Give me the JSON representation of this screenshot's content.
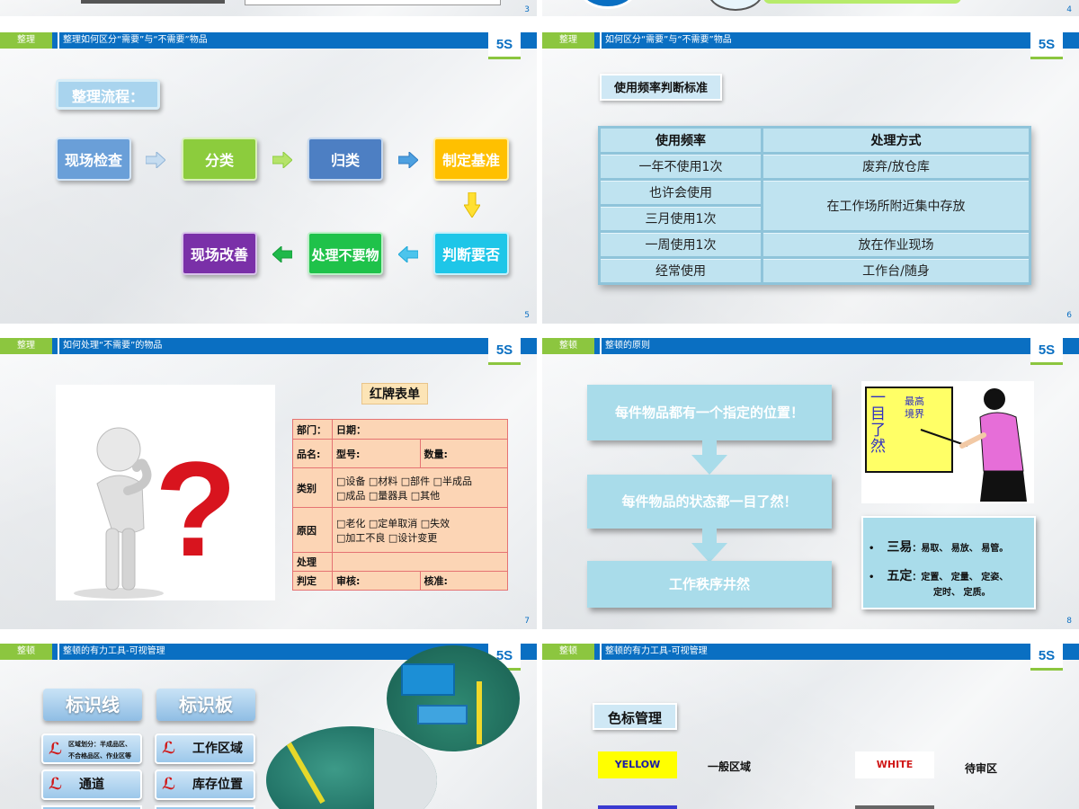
{
  "top": {
    "page3": "3",
    "page4": "4"
  },
  "s5": {
    "tag": "整理",
    "title": "整理如何区分“需要”与“不需要”物品",
    "logo": "5S",
    "page": "5",
    "heading": "整理流程：",
    "steps": [
      "现场检查",
      "分类",
      "归类",
      "制定基准",
      "判断要否",
      "处理不要物",
      "现场改善"
    ]
  },
  "s6": {
    "tag": "整理",
    "title": "如何区分“需要”与“不需要”物品",
    "logo": "5S",
    "page": "6",
    "heading": "使用频率判断标准",
    "headers": [
      "使用频率",
      "处理方式"
    ],
    "rows": [
      [
        "一年不使用1次",
        "废弃/放仓库"
      ],
      [
        "也许会使用",
        "在工作场所附近集中存放"
      ],
      [
        "三月使用1次",
        ""
      ],
      [
        "一周使用1次",
        "放在作业现场"
      ],
      [
        "经常使用",
        "工作台/随身"
      ]
    ]
  },
  "s7": {
    "tag": "整理",
    "title": "如何处理“不需要”的物品",
    "logo": "5S",
    "page": "7",
    "form_title": "红牌表单",
    "dept": "部门：",
    "date": "日期：",
    "name": "品名:",
    "model": "型号:",
    "qty": "数量:",
    "cat_label": "类别",
    "cat_opts1": "□设备 □材料 □部件 □半成品",
    "cat_opts2": "□成品 □量器具 □其他",
    "reason_label": "原因",
    "reason_opts1": "□老化 □定单取消 □失效",
    "reason_opts2": "□加工不良 □设计变更",
    "handle": "处理",
    "judge": "判定",
    "review": "审核:",
    "approve": "核准:"
  },
  "s8": {
    "tag": "整顿",
    "title": "整顿的原则",
    "logo": "5S",
    "page": "8",
    "boxes": [
      "每件物品都有一个指定的位置！",
      "每件物品的状态都一目了然！",
      "工作秩序井然"
    ],
    "board_big": "一目了然",
    "board_small": "最高境界",
    "b1_label": "三易",
    "b1_text": "：易取、 易放、 易管。",
    "b2_label": "五定",
    "b2_text": "：定置、 定量、 定姿、",
    "b2_text2": "定时、 定质。"
  },
  "s9": {
    "tag": "整顿",
    "title": "整顿的有力工具-可视管理",
    "logo": "5S",
    "col1": "标识线",
    "col2": "标识板",
    "small_text1": "区域划分：半成品区、",
    "small_text2": "不合格品区、作业区等",
    "btn_work": "工作区域",
    "btn_channel": "通道",
    "btn_stock": "库存位置"
  },
  "s10": {
    "tag": "整顿",
    "title": "整顿的有力工具-可视管理",
    "logo": "5S",
    "heading": "色标管理",
    "yellow": "YELLOW",
    "yellow_desc": "一般区域",
    "white": "WHITE",
    "white_desc": "待审区"
  }
}
